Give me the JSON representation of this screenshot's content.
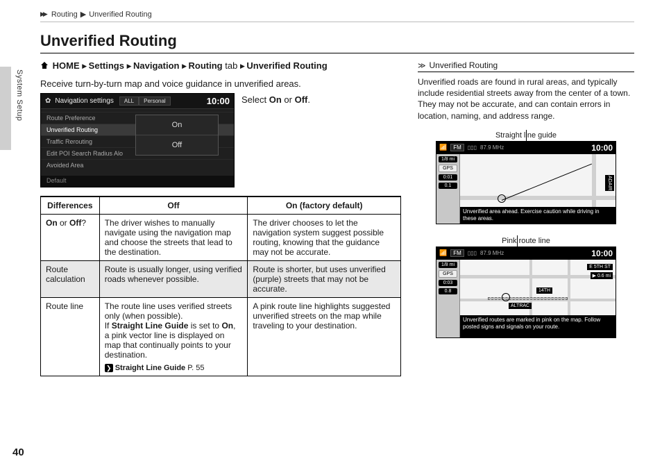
{
  "running_head": {
    "section": "Routing",
    "page": "Unverified Routing"
  },
  "side_tab": "System Setup",
  "page_number": "40",
  "title": "Unverified Routing",
  "path": {
    "home": "HOME",
    "p1": "Settings",
    "p2": "Navigation",
    "p3": "Routing",
    "tab_word": "tab",
    "p4": "Unverified Routing"
  },
  "intro": "Receive turn-by-turn map and voice guidance in unverified areas.",
  "select_text_prefix": "Select ",
  "select_on": "On",
  "select_or": " or ",
  "select_off": "Off",
  "select_period": ".",
  "device": {
    "title": "Navigation settings",
    "tab_all": "ALL",
    "tab_personal": "Personal",
    "clock": "10:00",
    "items": {
      "a": "Route Preference",
      "b": "Unverified Routing",
      "c": "Traffic Rerouting",
      "d": "Edit POI Search Radius Alo",
      "e": "Avoided Area"
    },
    "popup": {
      "on": "On",
      "off": "Off"
    },
    "default": "Default"
  },
  "table": {
    "h1": "Differences",
    "h2": "Off",
    "h3_pre": "On ",
    "h3_bold": "(factory default)",
    "r1": {
      "c1_pre": "On",
      "c1_mid": " or ",
      "c1_b2": "Off",
      "c1_q": "?",
      "c2": "The driver wishes to manually navigate using the navigation map and choose the streets that lead to the destination.",
      "c3": "The driver chooses to let the navigation system suggest possible routing, knowing that the guidance may not be accurate."
    },
    "r2": {
      "c1": "Route calculation",
      "c2": "Route is usually longer, using verified roads whenever possible.",
      "c3": "Route is shorter, but uses unverified (purple) streets that may not be accurate."
    },
    "r3": {
      "c1": "Route line",
      "c2a": "The route line uses verified streets only (when possible).",
      "c2b_pre": "If ",
      "c2b_b1": "Straight Line Guide",
      "c2b_mid": " is set to ",
      "c2b_b2": "On",
      "c2b_post": ", a pink vector line is displayed on map that continually points to your destination.",
      "c2_xref": "Straight Line Guide",
      "c2_xref_page": " P. 55",
      "c3": "A pink route line highlights suggested unverified streets on the map while traveling to your destination."
    }
  },
  "sidebar": {
    "head": "Unverified Routing",
    "para": "Unverified roads are found in rural areas, and typically include residential streets away from the center of a town. They may not be accurate, and can contain errors in location, naming, and address range.",
    "fig1_caption": "Straight line guide",
    "fig2_caption": "Pink route line",
    "nav": {
      "fm": "FM",
      "rds": "87.9 MHz",
      "clock": "10:00",
      "dist": "1/8 mi",
      "gps": "GPS",
      "eta1": "0:01",
      "eta2": "0.1",
      "eta3": "0:03",
      "eta4": "0.8",
      "road1": "ADAIR",
      "road2": "ALTRAC",
      "road3": "14TH",
      "road4": "E 5TH ST",
      "dist2": "0.6 mi",
      "msg1": "Unverified area ahead. Exercise caution while driving in these areas.",
      "msg2a": "Unverified routes are marked in pink on the map. Follow posted signs and signals on your route."
    }
  }
}
